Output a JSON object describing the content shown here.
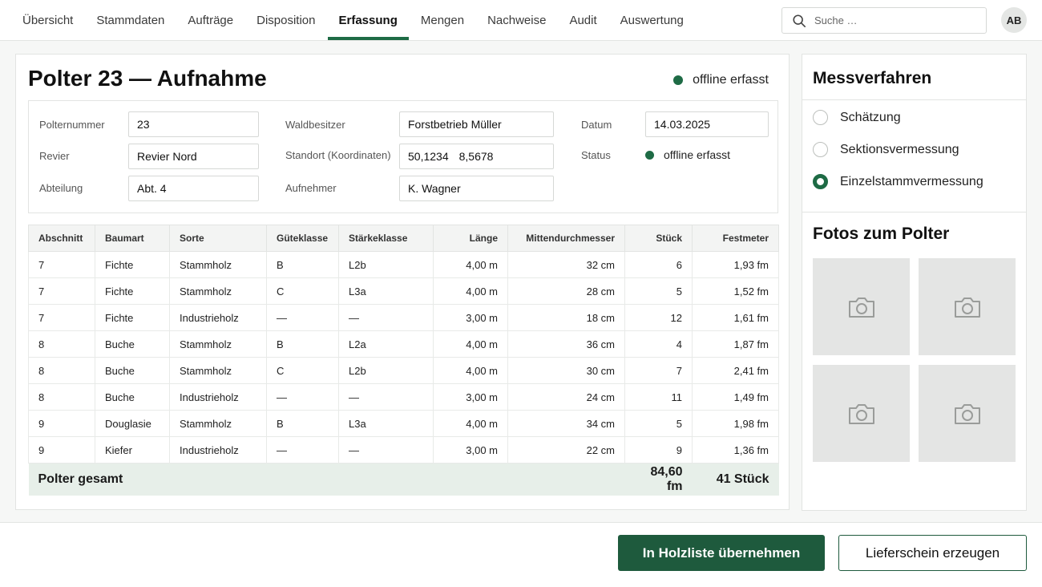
{
  "nav": {
    "items": [
      {
        "label": "Übersicht"
      },
      {
        "label": "Stammdaten"
      },
      {
        "label": "Aufträge"
      },
      {
        "label": "Disposition"
      },
      {
        "label": "Erfassung"
      },
      {
        "label": "Mengen"
      },
      {
        "label": "Nachweise"
      },
      {
        "label": "Audit"
      },
      {
        "label": "Auswertung"
      }
    ],
    "active": "Erfassung"
  },
  "search": {
    "placeholder": "Suche …",
    "icon": "search-icon"
  },
  "user": {
    "initials": "AB"
  },
  "main": {
    "title": "Polter 23 — Aufnahme",
    "status": "offline erfasst",
    "status_color": "#1e6b45"
  },
  "form": {
    "polternummer": {
      "label": "Polternummer",
      "value": "23"
    },
    "revier": {
      "label": "Revier",
      "value": "Revier Nord"
    },
    "abteilung": {
      "label": "Abteilung",
      "value": "Abt. 4"
    },
    "waldbesitzer": {
      "label": "Waldbesitzer",
      "value": "Forstbetrieb Müller"
    },
    "standort": {
      "label": "Standort (Koordinaten)",
      "lat": "50,1234",
      "lon": "8,5678"
    },
    "aufnehmer": {
      "label": "Aufnehmer",
      "value": "K. Wagner"
    },
    "datum": {
      "label": "Datum",
      "value": "14.03.2025"
    },
    "status": {
      "label": "Status",
      "value": "offline erfasst"
    }
  },
  "table": {
    "headers": [
      "Abschnitt",
      "Baumart",
      "Sorte",
      "Güteklasse",
      "Stärkeklasse",
      "Länge",
      "Mittendurchmesser",
      "Stück",
      "Festmeter"
    ],
    "rows": [
      [
        "7",
        "Fichte",
        "Stammholz",
        "B",
        "L2b",
        "4,00 m",
        "32 cm",
        "6",
        "1,93 fm"
      ],
      [
        "7",
        "Fichte",
        "Stammholz",
        "C",
        "L3a",
        "4,00 m",
        "28 cm",
        "5",
        "1,52 fm"
      ],
      [
        "7",
        "Fichte",
        "Industrieholz",
        "—",
        "—",
        "3,00 m",
        "18 cm",
        "12",
        "1,61 fm"
      ],
      [
        "8",
        "Buche",
        "Stammholz",
        "B",
        "L2a",
        "4,00 m",
        "36 cm",
        "4",
        "1,87 fm"
      ],
      [
        "8",
        "Buche",
        "Stammholz",
        "C",
        "L2b",
        "4,00 m",
        "30 cm",
        "7",
        "2,41 fm"
      ],
      [
        "8",
        "Buche",
        "Industrieholz",
        "—",
        "—",
        "3,00 m",
        "24 cm",
        "11",
        "1,49 fm"
      ],
      [
        "9",
        "Douglasie",
        "Stammholz",
        "B",
        "L3a",
        "4,00 m",
        "34 cm",
        "5",
        "1,98 fm"
      ],
      [
        "9",
        "Kiefer",
        "Industrieholz",
        "—",
        "—",
        "3,00 m",
        "22 cm",
        "9",
        "1,36 fm"
      ]
    ],
    "total": {
      "label": "Polter gesamt",
      "festmeter": "84,60 fm",
      "stueck": "41 Stück"
    }
  },
  "side": {
    "method_title": "Messverfahren",
    "methods": [
      {
        "label": "Schätzung",
        "checked": false
      },
      {
        "label": "Sektionsvermessung",
        "checked": false
      },
      {
        "label": "Einzelstammvermessung",
        "checked": true
      }
    ],
    "photos_title": "Fotos zum Polter",
    "photo_icon": "camera-icon"
  },
  "actions": {
    "primary": "In Holzliste übernehmen",
    "secondary": "Lieferschein erzeugen"
  }
}
